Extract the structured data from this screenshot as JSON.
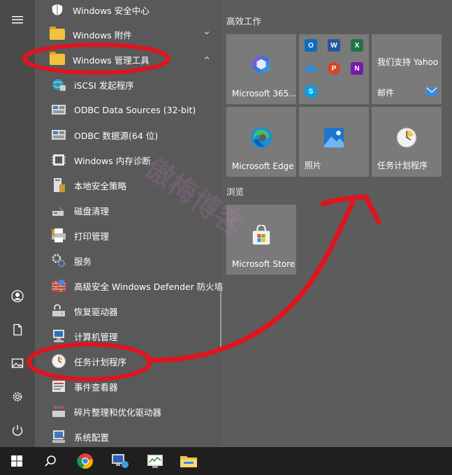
{
  "rail": {
    "items": [
      {
        "name": "hamburger-menu-icon"
      },
      {
        "name": "user-icon"
      },
      {
        "name": "documents-icon"
      },
      {
        "name": "pictures-icon"
      },
      {
        "name": "settings-icon"
      },
      {
        "name": "power-icon"
      }
    ]
  },
  "applist": {
    "items": [
      {
        "label": "Windows 安全中心",
        "icon": "shield-icon"
      },
      {
        "label": "Windows 附件",
        "icon": "folder-icon",
        "expand": "collapsed"
      },
      {
        "label": "Windows 管理工具",
        "icon": "folder-icon",
        "expand": "expanded"
      },
      {
        "label": "iSCSI 发起程序",
        "icon": "iscsi-globe-icon"
      },
      {
        "label": "ODBC Data Sources (32-bit)",
        "icon": "odbc-icon"
      },
      {
        "label": "ODBC 数据源(64 位)",
        "icon": "odbc-icon"
      },
      {
        "label": "Windows 内存诊断",
        "icon": "memory-chip-icon"
      },
      {
        "label": "本地安全策略",
        "icon": "security-policy-icon"
      },
      {
        "label": "磁盘清理",
        "icon": "disk-cleanup-icon"
      },
      {
        "label": "打印管理",
        "icon": "printer-icon"
      },
      {
        "label": "服务",
        "icon": "services-gear-icon"
      },
      {
        "label": "高级安全 Windows Defender 防火墙",
        "icon": "firewall-icon"
      },
      {
        "label": "恢复驱动器",
        "icon": "recovery-drive-icon"
      },
      {
        "label": "计算机管理",
        "icon": "computer-management-icon"
      },
      {
        "label": "任务计划程序",
        "icon": "task-scheduler-clock-icon"
      },
      {
        "label": "事件查看器",
        "icon": "event-viewer-icon"
      },
      {
        "label": "碎片整理和优化驱动器",
        "icon": "defrag-icon"
      },
      {
        "label": "系统配置",
        "icon": "system-config-icon"
      }
    ]
  },
  "tiles": {
    "groups": [
      {
        "title": "高效工作"
      },
      {
        "title": "浏览"
      }
    ],
    "items": [
      {
        "label": "Microsoft 365...",
        "icon": "microsoft-365-icon"
      },
      {
        "label": "",
        "icon": "office-apps-icon"
      },
      {
        "label": "我们支持 Yahoo",
        "sublabel": "邮件",
        "icon": "mail-icon"
      },
      {
        "label": "Microsoft Edge",
        "icon": "edge-icon"
      },
      {
        "label": "照片",
        "icon": "photos-icon"
      },
      {
        "label": "任务计划程序",
        "icon": "task-scheduler-clock-icon"
      },
      {
        "label": "Microsoft Store",
        "icon": "store-icon"
      }
    ],
    "office_minis": [
      "O",
      "W",
      "X",
      "",
      "P",
      "N",
      "S"
    ]
  },
  "taskbar": {
    "items": [
      {
        "name": "start-button"
      },
      {
        "name": "search-icon"
      },
      {
        "name": "chrome-icon"
      },
      {
        "name": "remote-desktop-icon"
      },
      {
        "name": "system-monitor-icon"
      },
      {
        "name": "file-explorer-icon"
      }
    ]
  },
  "watermark": "傲梅博客",
  "colors": {
    "annotation": "#e0141e",
    "tile": "#7a7a7a",
    "panel": "#595959"
  }
}
